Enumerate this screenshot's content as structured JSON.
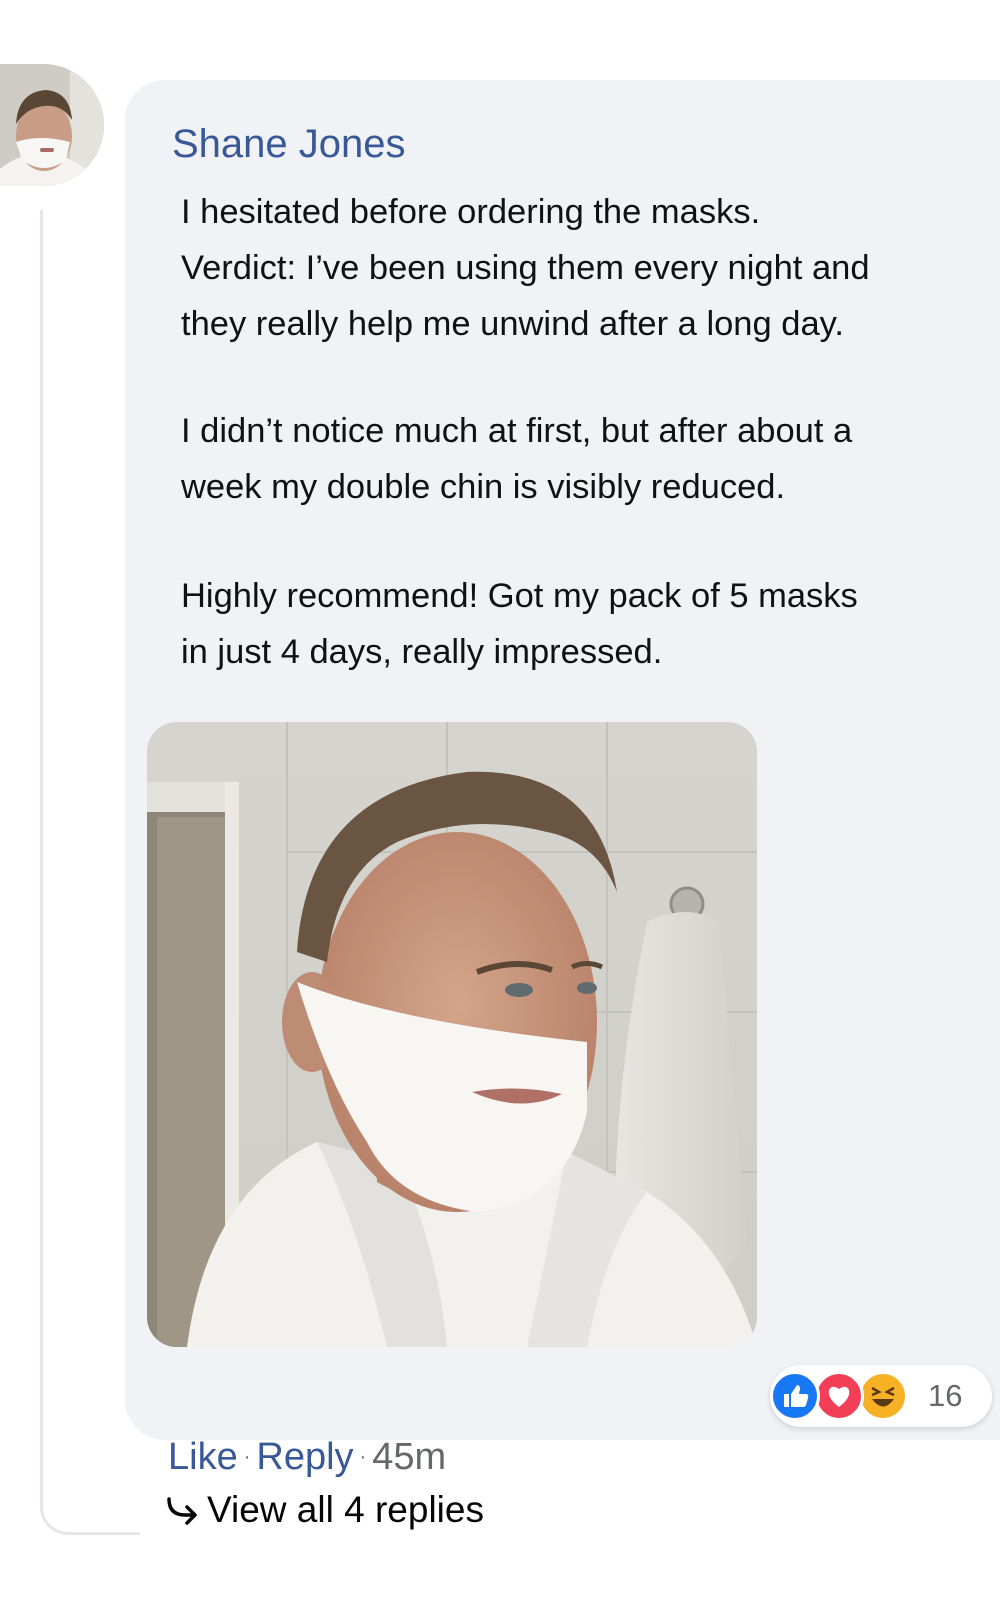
{
  "comment": {
    "author": "Shane Jones",
    "paragraphs": [
      [
        "I hesitated before ordering the masks.",
        "Verdict: I’ve been using them every night and",
        "they really help me unwind after a long day."
      ],
      [
        "I didn’t notice much at first, but after about a",
        "week my double chin is visibly reduced."
      ],
      [
        "Highly recommend! Got my pack of 5 masks",
        "in just 4 days, really impressed."
      ]
    ],
    "reactions": {
      "icons": [
        "like-icon",
        "love-icon",
        "haha-icon"
      ],
      "count": "16"
    }
  },
  "actions": {
    "like_label": "Like",
    "separator": "·",
    "reply_label": "Reply",
    "time": "45m"
  },
  "replies": {
    "view_label": "View all 4 replies"
  },
  "colors": {
    "link": "#385898",
    "bubble": "#f0f2f5",
    "like": "#1877f2",
    "love": "#f33e58",
    "haha": "#f7b125"
  }
}
